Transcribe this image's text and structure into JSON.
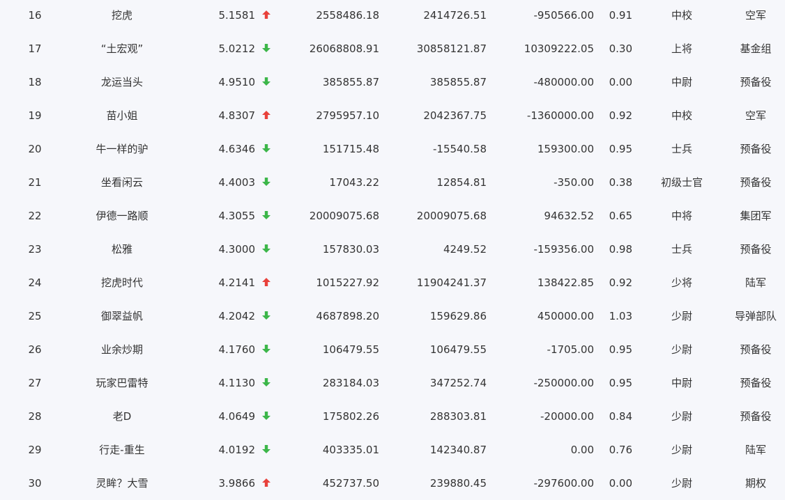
{
  "colors": {
    "up": "#e8413b",
    "down": "#3cb649",
    "text": "#333333",
    "background": "#f6f7fb"
  },
  "rows": [
    {
      "rank": "16",
      "name": "挖虎",
      "score": "5.1581",
      "trend": "up",
      "v1": "2558486.18",
      "v2": "2414726.51",
      "v3": "-950566.00",
      "ratio": "0.91",
      "title": "中校",
      "branch": "空军"
    },
    {
      "rank": "17",
      "name": "“土宏观”",
      "score": "5.0212",
      "trend": "down",
      "v1": "26068808.91",
      "v2": "30858121.87",
      "v3": "10309222.05",
      "ratio": "0.30",
      "title": "上将",
      "branch": "基金组"
    },
    {
      "rank": "18",
      "name": "龙运当头",
      "score": "4.9510",
      "trend": "down",
      "v1": "385855.87",
      "v2": "385855.87",
      "v3": "-480000.00",
      "ratio": "0.00",
      "title": "中尉",
      "branch": "预备役"
    },
    {
      "rank": "19",
      "name": "苗小姐",
      "score": "4.8307",
      "trend": "up",
      "v1": "2795957.10",
      "v2": "2042367.75",
      "v3": "-1360000.00",
      "ratio": "0.92",
      "title": "中校",
      "branch": "空军"
    },
    {
      "rank": "20",
      "name": "牛一样的驴",
      "score": "4.6346",
      "trend": "down",
      "v1": "151715.48",
      "v2": "-15540.58",
      "v3": "159300.00",
      "ratio": "0.95",
      "title": "士兵",
      "branch": "预备役"
    },
    {
      "rank": "21",
      "name": "坐看闲云",
      "score": "4.4003",
      "trend": "down",
      "v1": "17043.22",
      "v2": "12854.81",
      "v3": "-350.00",
      "ratio": "0.38",
      "title": "初级士官",
      "branch": "预备役"
    },
    {
      "rank": "22",
      "name": "伊德一路顺",
      "score": "4.3055",
      "trend": "down",
      "v1": "20009075.68",
      "v2": "20009075.68",
      "v3": "94632.52",
      "ratio": "0.65",
      "title": "中将",
      "branch": "集团军"
    },
    {
      "rank": "23",
      "name": "松雅",
      "score": "4.3000",
      "trend": "down",
      "v1": "157830.03",
      "v2": "4249.52",
      "v3": "-159356.00",
      "ratio": "0.98",
      "title": "士兵",
      "branch": "预备役"
    },
    {
      "rank": "24",
      "name": "挖虎时代",
      "score": "4.2141",
      "trend": "up",
      "v1": "1015227.92",
      "v2": "11904241.37",
      "v3": "138422.85",
      "ratio": "0.92",
      "title": "少将",
      "branch": "陆军"
    },
    {
      "rank": "25",
      "name": "御翠益帆",
      "score": "4.2042",
      "trend": "down",
      "v1": "4687898.20",
      "v2": "159629.86",
      "v3": "450000.00",
      "ratio": "1.03",
      "title": "少尉",
      "branch": "导弹部队"
    },
    {
      "rank": "26",
      "name": "业余炒期",
      "score": "4.1760",
      "trend": "down",
      "v1": "106479.55",
      "v2": "106479.55",
      "v3": "-1705.00",
      "ratio": "0.95",
      "title": "少尉",
      "branch": "预备役"
    },
    {
      "rank": "27",
      "name": "玩家巴雷特",
      "score": "4.1130",
      "trend": "down",
      "v1": "283184.03",
      "v2": "347252.74",
      "v3": "-250000.00",
      "ratio": "0.95",
      "title": "中尉",
      "branch": "预备役"
    },
    {
      "rank": "28",
      "name": "老D",
      "score": "4.0649",
      "trend": "down",
      "v1": "175802.26",
      "v2": "288303.81",
      "v3": "-20000.00",
      "ratio": "0.84",
      "title": "少尉",
      "branch": "预备役"
    },
    {
      "rank": "29",
      "name": "行走-重生",
      "score": "4.0192",
      "trend": "down",
      "v1": "403335.01",
      "v2": "142340.87",
      "v3": "0.00",
      "ratio": "0.76",
      "title": "少尉",
      "branch": "陆军"
    },
    {
      "rank": "30",
      "name": "灵眸？大雪",
      "score": "3.9866",
      "trend": "up",
      "v1": "452737.50",
      "v2": "239880.45",
      "v3": "-297600.00",
      "ratio": "0.00",
      "title": "少尉",
      "branch": "期权"
    }
  ]
}
